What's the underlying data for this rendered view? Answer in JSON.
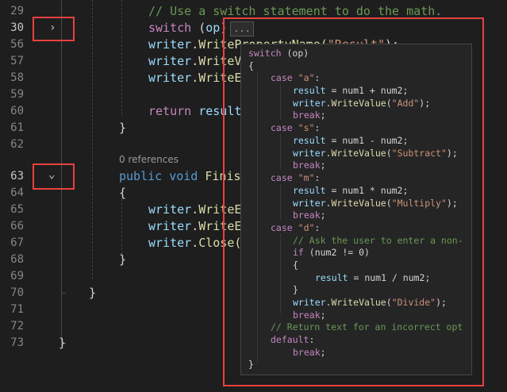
{
  "line_numbers": [
    "29",
    "30",
    "56",
    "57",
    "58",
    "59",
    "60",
    "61",
    "62",
    "63",
    "64",
    "65",
    "66",
    "67",
    "68",
    "69",
    "70",
    "71",
    "72",
    "73"
  ],
  "editor": {
    "l29_comment": "// Use a switch statement to do the math.",
    "l30_switch": "switch",
    "l30_paren_open": " (",
    "l30_op": "op",
    "l30_paren_close": ")",
    "l30_ellipsis": "...",
    "l56_writer": "writer",
    "l56_dot": ".",
    "l56_method": "WriteP",
    "l56_rest": "ropertyName(",
    "l56_str": "\"Result\"",
    "l56_end": ");",
    "l57_writer": "writer",
    "l57_dot": ".",
    "l57_method": "WriteV",
    "l58_writer": "writer",
    "l58_dot": ".",
    "l58_method": "WriteE",
    "l60_return": "return",
    "l60_result": " result",
    "l61_brace": "}",
    "codelens": "0 references",
    "l63_public": "public",
    "l63_void": " void",
    "l63_finish": " Finis",
    "l64_brace": "{",
    "l65_writer": "writer",
    "l65_dot": ".",
    "l65_method": "WriteE",
    "l66_writer": "writer",
    "l66_dot": ".",
    "l66_method": "WriteE",
    "l67_writer": "writer",
    "l67_dot": ".",
    "l67_method": "Close(",
    "l68_brace": "}",
    "l70_brace": "}",
    "l73_brace": "}"
  },
  "peek": {
    "l1_kw": "switch",
    "l1_rest": " (op)",
    "l2": "{",
    "case_a_kw": "case",
    "case_a_str": "\"a\"",
    "case_a_colon": ":",
    "a_body_result": "result",
    "a_body_expr": " = num1 + num2;",
    "a_writer": "writer",
    "a_dot": ".",
    "a_method": "WriteValue",
    "a_open": "(",
    "a_str": "\"Add\"",
    "a_close": ");",
    "a_break": "break",
    "a_semi": ";",
    "case_s_kw": "case",
    "case_s_str": "\"s\"",
    "case_s_colon": ":",
    "s_body_result": "result",
    "s_body_expr": " = num1 - num2;",
    "s_writer": "writer",
    "s_dot": ".",
    "s_method": "WriteValue",
    "s_open": "(",
    "s_str": "\"Subtract\"",
    "s_close": ");",
    "s_break": "break",
    "s_semi": ";",
    "case_m_kw": "case",
    "case_m_str": "\"m\"",
    "case_m_colon": ":",
    "m_body_result": "result",
    "m_body_expr": " = num1 * num2;",
    "m_writer": "writer",
    "m_dot": ".",
    "m_method": "WriteValue",
    "m_open": "(",
    "m_str": "\"Multiply\"",
    "m_close": ");",
    "m_break": "break",
    "m_semi": ";",
    "case_d_kw": "case",
    "case_d_str": "\"d\"",
    "case_d_colon": ":",
    "d_comment": "// Ask the user to enter a non-",
    "d_if": "if",
    "d_if_rest": " (num2 != 0)",
    "d_open_brace": "{",
    "d_result": "result",
    "d_result_expr": " = num1 / num2;",
    "d_close_brace": "}",
    "d_writer": "writer",
    "d_dot": ".",
    "d_method": "WriteValue",
    "d_open": "(",
    "d_str": "\"Divide\"",
    "d_close": ");",
    "d_break": "break",
    "d_semi": ";",
    "default_comment": "// Return text for an incorrect opt",
    "default_kw": "default",
    "default_colon": ":",
    "default_break": "break",
    "default_semi": ";",
    "last": "}"
  },
  "fold_icons": {
    "collapsed": "chevron-right-icon",
    "expanded": "chevron-down-icon"
  },
  "colors": {
    "highlight_box": "#e8413f",
    "keyword": "#c586c0",
    "type_keyword": "#569cd6",
    "method": "#dcdcaa",
    "string": "#ce9178",
    "comment": "#6a9955"
  }
}
